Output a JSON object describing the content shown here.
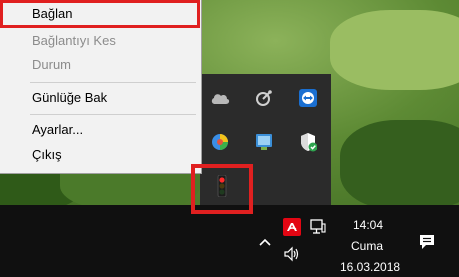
{
  "menu": {
    "items": [
      {
        "label": "Bağlan",
        "enabled": true
      },
      {
        "label": "Bağlantıyı Kes",
        "enabled": false
      },
      {
        "label": "Durum",
        "enabled": false
      },
      {
        "label": "Günlüğe Bak",
        "enabled": true
      },
      {
        "label": "Ayarlar...",
        "enabled": true
      },
      {
        "label": "Çıkış",
        "enabled": true
      }
    ],
    "highlighted_item": "Bağlan"
  },
  "tray_flyout": {
    "icons": [
      "onedrive-cloud-icon",
      "satellite-dish-icon",
      "teamviewer-icon",
      "colorful-shield-icon",
      "network-adapter-icon",
      "windows-defender-icon",
      "traffic-light-vpn-icon"
    ]
  },
  "taskbar": {
    "clock_time": "14:04",
    "clock_day": "Cuma",
    "clock_date": "16.03.2018",
    "icons": [
      "chevron-up-icon",
      "avira-icon",
      "network-icon",
      "volume-icon",
      "action-center-icon"
    ]
  },
  "colors": {
    "highlight": "#e02020",
    "menu_background": "#f2f2f2",
    "disabled_text": "#8c8c8c",
    "taskbar": "#101010",
    "flyout": "#2b2b2b",
    "avira_red": "#e30613"
  }
}
